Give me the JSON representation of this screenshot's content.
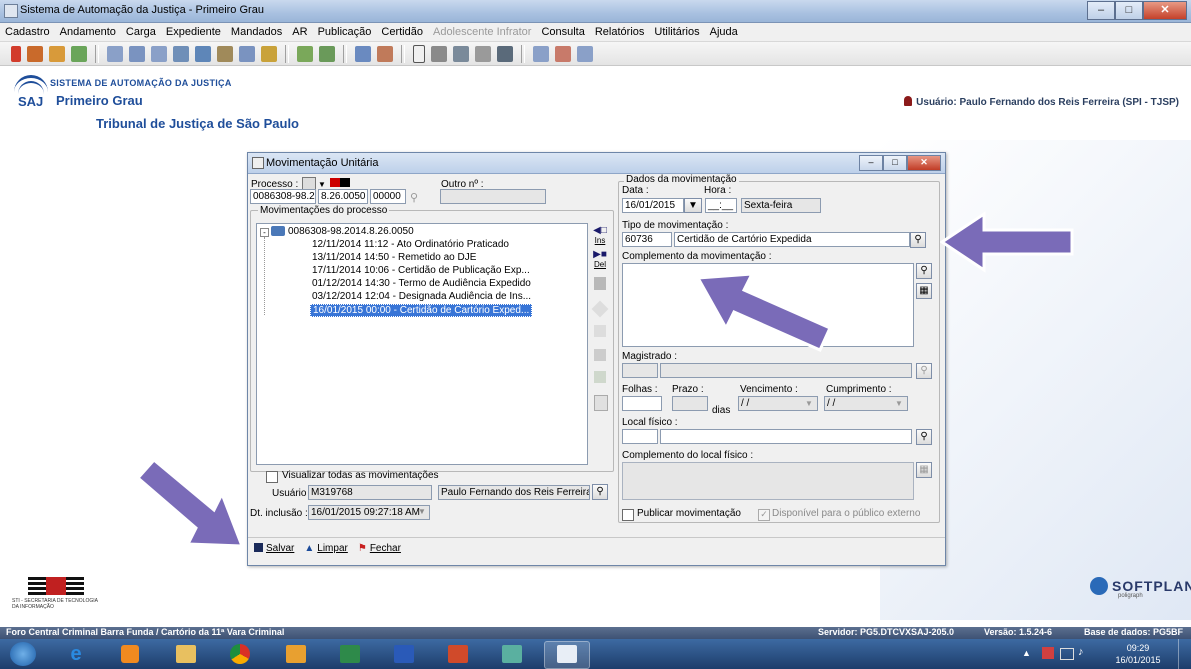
{
  "window": {
    "title": "Sistema de Automação da Justiça - Primeiro Grau"
  },
  "menu": [
    "Cadastro",
    "Andamento",
    "Carga",
    "Expediente",
    "Mandados",
    "AR",
    "Publicação",
    "Certidão",
    "Adolescente Infrator",
    "Consulta",
    "Relatórios",
    "Utilitários",
    "Ajuda"
  ],
  "header": {
    "logo_text": "SAJ",
    "sistema": "SISTEMA DE AUTOMAÇÃO DA JUSTIÇA",
    "grau": "Primeiro Grau",
    "tribunal": "Tribunal de Justiça de São Paulo",
    "usuario": "Usuário: Paulo Fernando dos Reis Ferreira (SPI - TJSP)"
  },
  "dialog": {
    "title": "Movimentação Unitária",
    "processo_label": "Processo :",
    "outro_label": "Outro nº :",
    "processo_num": "0086308-98.2014",
    "processo_foro": "8.26.0050",
    "processo_ext": "00000",
    "outro_value": "",
    "movimentacoes_label": "Movimentações do processo",
    "tree_root": "0086308-98.2014.8.26.0050",
    "tree_items": [
      "12/11/2014 11:12 - Ato Ordinatório Praticado",
      "13/11/2014 14:50 - Remetido ao DJE",
      "17/11/2014 10:06 - Certidão de Publicação Exp...",
      "01/12/2014 14:30 - Termo de Audiência Expedido",
      "03/12/2014 12:04 - Designada Audiência de Ins...",
      "16/01/2015 00:00 - Certidão de Cartório Exped..."
    ],
    "ins_label": "Ins",
    "del_label": "Del",
    "visualizar_label": "Visualizar todas as movimentações",
    "usuario_label": "Usuário :",
    "usuario_code": "M319768",
    "usuario_name": "Paulo Fernando dos Reis Ferreira (S",
    "dt_inclusao_label": "Dt. inclusão :",
    "dt_inclusao": "16/01/2015 09:27:18 AM",
    "dados_label": "Dados da movimentação",
    "data_label": "Data :",
    "hora_label": "Hora :",
    "data_value": "16/01/2015",
    "hora_value": "__:__",
    "dia_semana": "Sexta-feira",
    "tipo_label": "Tipo de movimentação :",
    "tipo_code": "60736",
    "tipo_desc": "Certidão de Cartório Expedida",
    "complemento_label": "Complemento da movimentação :",
    "magistrado_label": "Magistrado :",
    "folhas_label": "Folhas :",
    "prazo_label": "Prazo :",
    "dias_label": "dias",
    "vencimento_label": "Vencimento :",
    "cumprimento_label": "Cumprimento :",
    "vencimento_value": "/ /",
    "cumprimento_value": "/ /",
    "local_label": "Local físico :",
    "complemento_local_label": "Complemento do local físico :",
    "publicar_label": "Publicar movimentação",
    "disponivel_label": "Disponível para o público externo",
    "salvar": "Salvar",
    "limpar": "Limpar",
    "fechar": "Fechar"
  },
  "footer": {
    "sti": "STI - SECRETARIA DE TECNOLOGIA DA INFORMAÇÃO",
    "softplan": "SOFTPLAN",
    "poligraph": "poligraph"
  },
  "status": {
    "foro": "Foro Central Criminal Barra Funda / Cartório da 11ª Vara Criminal",
    "servidor": "Servidor: PG5.DTCVXSAJ-205.0",
    "versao": "Versão: 1.5.24-6",
    "base": "Base de dados: PG5BF"
  },
  "taskbar": {
    "time": "09:29",
    "date": "16/01/2015"
  },
  "colors": {
    "accent": "#1f4e9a",
    "arrow": "#7a6bb8",
    "selection": "#3875d7"
  }
}
